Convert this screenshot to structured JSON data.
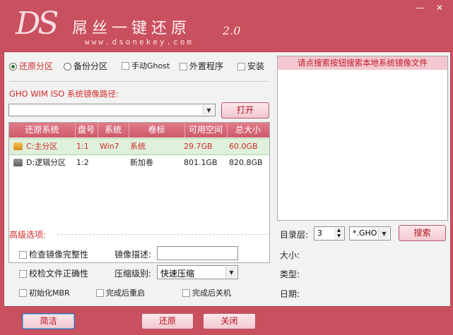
{
  "app": {
    "logo": "DS",
    "title": "屌丝一键还原",
    "version": "2.0",
    "domain": "www.dsonekey.com",
    "min_symbol": "—",
    "close_symbol": "✕"
  },
  "options": {
    "restore": "还原分区",
    "backup": "备份分区",
    "manual_ghost": "手动Ghost",
    "external": "外置程序",
    "install": "安装"
  },
  "image_path": {
    "label": "GHO WIM ISO 系统镜像路径:",
    "value": "",
    "open_button": "打开"
  },
  "table": {
    "columns": [
      "还原系统",
      "盘号",
      "系统",
      "卷标",
      "可用空间",
      "总大小"
    ],
    "rows": [
      {
        "name": "C:主分区",
        "disk": "1:1",
        "os": "Win7",
        "label": "系统",
        "free": "29.7GB",
        "total": "60.0GB"
      },
      {
        "name": "D:逻辑分区",
        "disk": "1:2",
        "os": "",
        "label": "新加卷",
        "free": "801.1GB",
        "total": "820.8GB"
      }
    ]
  },
  "search_panel": {
    "header": "请点搜索按钮搜索本地系统镜像文件",
    "dir_level_label": "目录层:",
    "dir_level": "3",
    "ext": "*.GHO",
    "search_button": "搜索",
    "size_label": "大小:",
    "type_label": "类型:",
    "date_label": "日期:"
  },
  "advanced": {
    "title": "高级选项:",
    "verify_integrity": "检查镜像完整性",
    "verify_files": "校检文件正确性",
    "init_mbr": "初始化MBR",
    "restart_after": "完成后重启",
    "shutdown_after": "完成后关机",
    "desc_label": "镜像描述:",
    "desc_value": "",
    "compress_label": "压缩级别:",
    "compress_value": "快速压缩"
  },
  "buttons": {
    "simple": "简洁",
    "restore": "还原",
    "close": "关闭"
  },
  "colors": {
    "window_bg": "#c9505e",
    "accent_text": "#d12a2a",
    "table_header": "#d86474",
    "selected_row": "#dff0dc"
  }
}
